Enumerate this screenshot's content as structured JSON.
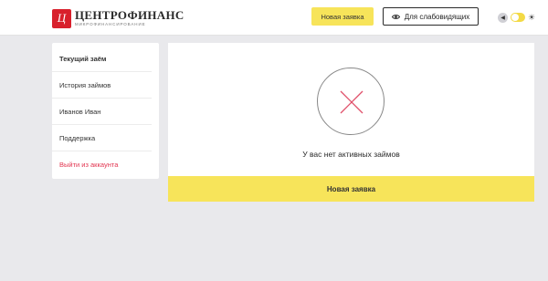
{
  "header": {
    "logo_mark": "Ц",
    "logo_name": "ЦЕНТРОФИНАНС",
    "logo_subtitle": "МИКРОФИНАНСИРОВАНИЕ",
    "new_request_label": "Новая заявка",
    "low_vision_label": "Для слабовидящих",
    "icons": {
      "eye": "eye-icon",
      "back": "chevron-left-icon",
      "sun": "sun-icon"
    },
    "theme_toggle_on": true
  },
  "sidebar": {
    "items": [
      {
        "label": "Текущий заём",
        "active": true
      },
      {
        "label": "История займов"
      },
      {
        "label": "Иванов Иван"
      },
      {
        "label": "Поддержка"
      },
      {
        "label": "Выйти из аккаунта",
        "danger": true
      }
    ]
  },
  "main": {
    "empty_message": "У вас нет активных займов",
    "new_request_label": "Новая заявка",
    "icon": "close-icon"
  },
  "colors": {
    "accent_yellow": "#f7e45a",
    "brand_red": "#d8202c",
    "logout_red": "#e2344f",
    "cross_pink": "#e0506a"
  }
}
